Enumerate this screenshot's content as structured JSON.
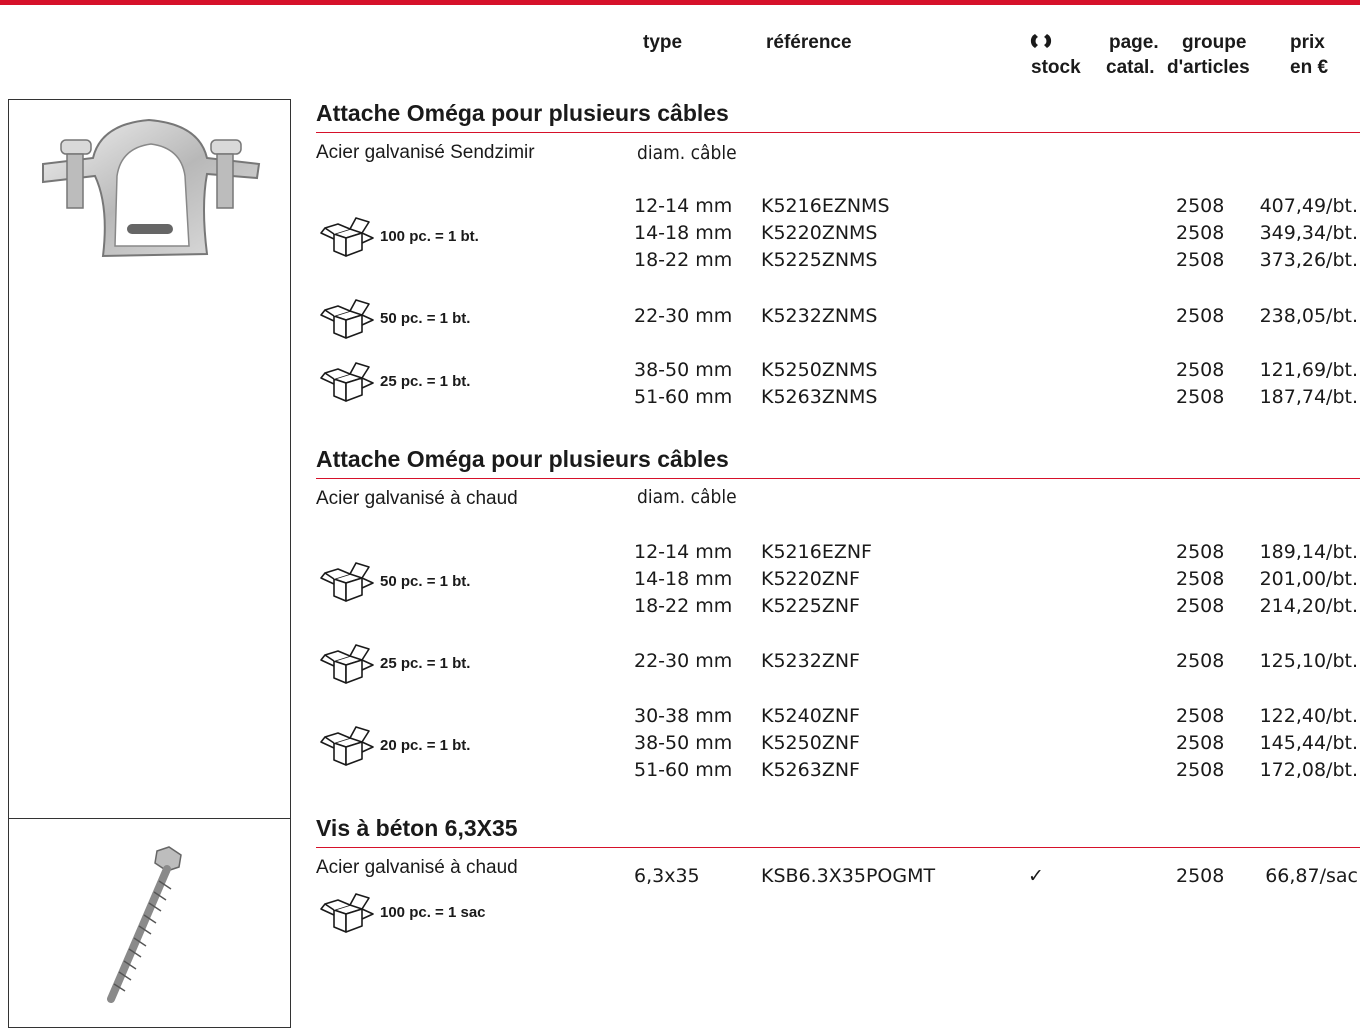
{
  "colors": {
    "accent": "#d6112a",
    "text": "#1a1a1a",
    "border": "#333333"
  },
  "header": {
    "type": "type",
    "reference": "référence",
    "stock_icon": "stock-symbol-icon",
    "stock": "stock",
    "page_line1": "page.",
    "page_line2": "catal.",
    "group_line1": "groupe",
    "group_line2": "d'articles",
    "price_line1": "prix",
    "price_line2": "en €"
  },
  "sections": [
    {
      "title": "Attache Oméga pour plusieurs câbles",
      "material": "Acier galvanisé Sendzimir",
      "column_label": "diam. câble",
      "packs": [
        {
          "label": "100 pc. = 1 bt."
        },
        {
          "label": "50 pc. = 1 bt."
        },
        {
          "label": "25 pc. = 1 bt."
        }
      ],
      "rows": [
        {
          "type": "12-14 mm",
          "ref": "K5216EZNMS",
          "stock": "",
          "group": "2508",
          "price": "407,49/bt."
        },
        {
          "type": "14-18 mm",
          "ref": "K5220ZNMS",
          "stock": "",
          "group": "2508",
          "price": "349,34/bt."
        },
        {
          "type": "18-22 mm",
          "ref": "K5225ZNMS",
          "stock": "",
          "group": "2508",
          "price": "373,26/bt."
        },
        {
          "type": "22-30 mm",
          "ref": "K5232ZNMS",
          "stock": "",
          "group": "2508",
          "price": "238,05/bt."
        },
        {
          "type": "38-50 mm",
          "ref": "K5250ZNMS",
          "stock": "",
          "group": "2508",
          "price": "121,69/bt."
        },
        {
          "type": "51-60 mm",
          "ref": "K5263ZNMS",
          "stock": "",
          "group": "2508",
          "price": "187,74/bt."
        }
      ]
    },
    {
      "title": "Attache Oméga pour plusieurs câbles",
      "material": "Acier galvanisé à chaud",
      "column_label": "diam. câble",
      "packs": [
        {
          "label": "50 pc. = 1 bt."
        },
        {
          "label": "25 pc. = 1 bt."
        },
        {
          "label": "20 pc. = 1 bt."
        }
      ],
      "rows": [
        {
          "type": "12-14 mm",
          "ref": "K5216EZNF",
          "stock": "",
          "group": "2508",
          "price": "189,14/bt."
        },
        {
          "type": "14-18 mm",
          "ref": "K5220ZNF",
          "stock": "",
          "group": "2508",
          "price": "201,00/bt."
        },
        {
          "type": "18-22 mm",
          "ref": "K5225ZNF",
          "stock": "",
          "group": "2508",
          "price": "214,20/bt."
        },
        {
          "type": "22-30 mm",
          "ref": "K5232ZNF",
          "stock": "",
          "group": "2508",
          "price": "125,10/bt."
        },
        {
          "type": "30-38 mm",
          "ref": "K5240ZNF",
          "stock": "",
          "group": "2508",
          "price": "122,40/bt."
        },
        {
          "type": "38-50 mm",
          "ref": "K5250ZNF",
          "stock": "",
          "group": "2508",
          "price": "145,44/bt."
        },
        {
          "type": "51-60 mm",
          "ref": "K5263ZNF",
          "stock": "",
          "group": "2508",
          "price": "172,08/bt."
        }
      ]
    },
    {
      "title": "Vis à béton 6,3X35",
      "material": "Acier galvanisé à chaud",
      "packs": [
        {
          "label": "100 pc. = 1 sac"
        }
      ],
      "rows": [
        {
          "type": "6,3x35",
          "ref": "KSB6.3X35POGMT",
          "stock": "✓",
          "group": "2508",
          "price": "66,87/sac"
        }
      ]
    }
  ],
  "images": [
    {
      "icon": "omega-clamp-image"
    },
    {
      "icon": "concrete-screw-image"
    }
  ]
}
